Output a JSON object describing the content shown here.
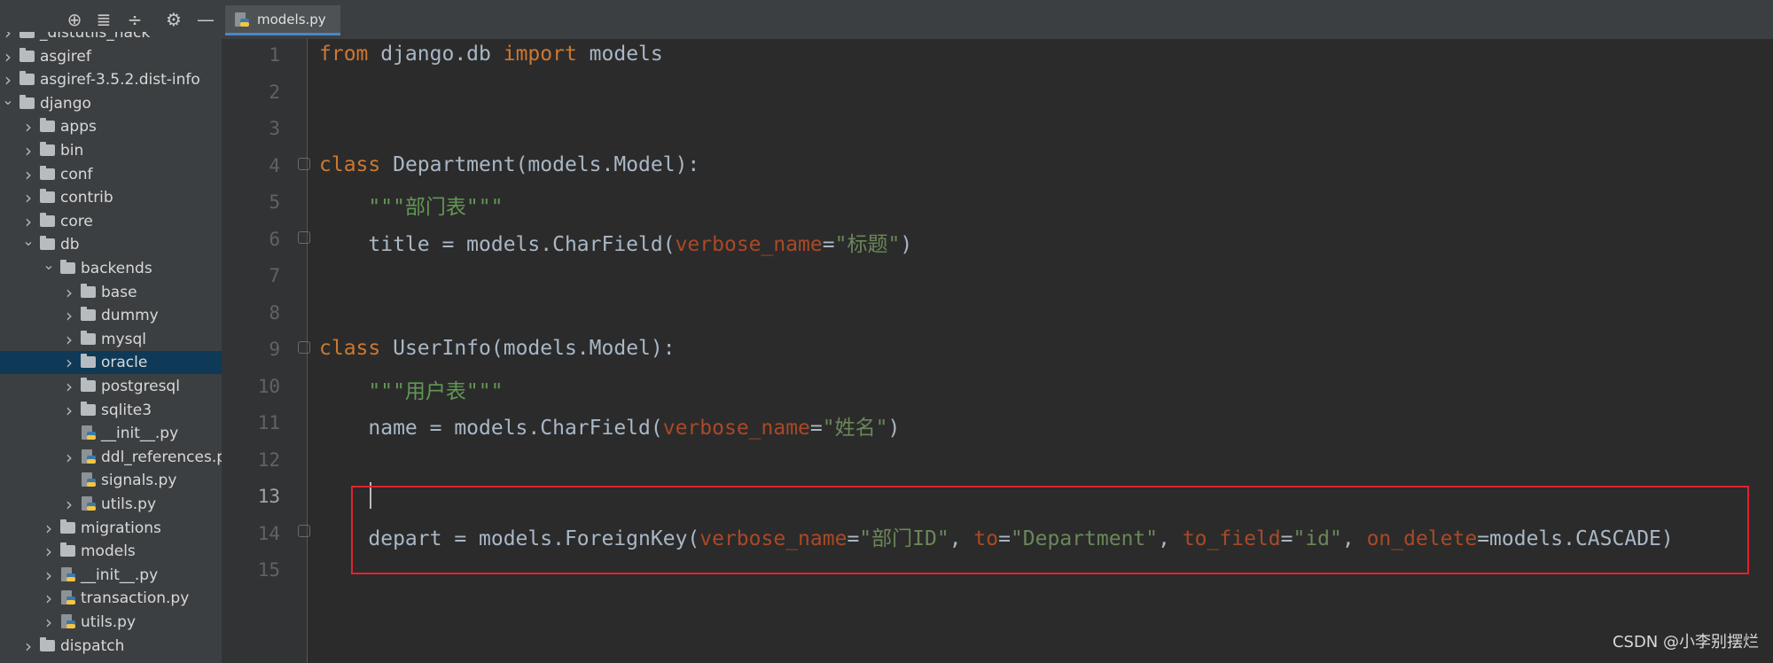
{
  "sidebar": {
    "toolbar": [
      {
        "icon": "crosshair-icon",
        "glyph": "⊕"
      },
      {
        "icon": "expand-all-icon",
        "glyph": "≣"
      },
      {
        "icon": "collapse-all-icon",
        "glyph": "÷"
      },
      {
        "icon": "gear-icon",
        "glyph": "⚙"
      },
      {
        "icon": "minimize-icon",
        "glyph": "—"
      }
    ],
    "tree": [
      {
        "label": "_distutils_hack",
        "type": "folder",
        "level": 0,
        "expanded": false
      },
      {
        "label": "asgiref",
        "type": "folder",
        "level": 0,
        "expanded": false
      },
      {
        "label": "asgiref-3.5.2.dist-info",
        "type": "folder",
        "level": 0,
        "expanded": false
      },
      {
        "label": "django",
        "type": "folder",
        "level": 0,
        "expanded": true
      },
      {
        "label": "apps",
        "type": "folder",
        "level": 1,
        "expanded": false
      },
      {
        "label": "bin",
        "type": "folder",
        "level": 1,
        "expanded": false
      },
      {
        "label": "conf",
        "type": "folder",
        "level": 1,
        "expanded": false
      },
      {
        "label": "contrib",
        "type": "folder",
        "level": 1,
        "expanded": false
      },
      {
        "label": "core",
        "type": "folder",
        "level": 1,
        "expanded": false
      },
      {
        "label": "db",
        "type": "folder",
        "level": 1,
        "expanded": true
      },
      {
        "label": "backends",
        "type": "folder",
        "level": 2,
        "expanded": true
      },
      {
        "label": "base",
        "type": "folder",
        "level": 3,
        "expanded": false
      },
      {
        "label": "dummy",
        "type": "folder",
        "level": 3,
        "expanded": false
      },
      {
        "label": "mysql",
        "type": "folder",
        "level": 3,
        "expanded": false
      },
      {
        "label": "oracle",
        "type": "folder",
        "level": 3,
        "expanded": false,
        "selected": true
      },
      {
        "label": "postgresql",
        "type": "folder",
        "level": 3,
        "expanded": false
      },
      {
        "label": "sqlite3",
        "type": "folder",
        "level": 3,
        "expanded": false
      },
      {
        "label": "__init__.py",
        "type": "file",
        "level": 3
      },
      {
        "label": "ddl_references.py",
        "type": "file",
        "level": 3,
        "expandable": true
      },
      {
        "label": "signals.py",
        "type": "file",
        "level": 3
      },
      {
        "label": "utils.py",
        "type": "file",
        "level": 3,
        "expandable": true
      },
      {
        "label": "migrations",
        "type": "folder",
        "level": 2,
        "expanded": false
      },
      {
        "label": "models",
        "type": "folder",
        "level": 2,
        "expanded": false
      },
      {
        "label": "__init__.py",
        "type": "file",
        "level": 2,
        "expandable": true
      },
      {
        "label": "transaction.py",
        "type": "file",
        "level": 2,
        "expandable": true
      },
      {
        "label": "utils.py",
        "type": "file",
        "level": 2,
        "expandable": true
      },
      {
        "label": "dispatch",
        "type": "folder",
        "level": 1,
        "expanded": false
      }
    ]
  },
  "tabs": [
    {
      "label": "models.py",
      "icon": "python-file-icon",
      "active": true
    }
  ],
  "editor": {
    "line_numbers": [
      "1",
      "2",
      "3",
      "4",
      "5",
      "6",
      "7",
      "8",
      "9",
      "10",
      "11",
      "12",
      "13",
      "14",
      "15"
    ],
    "current_line": "13",
    "lines": [
      [
        {
          "t": "from",
          "c": "kw"
        },
        {
          "t": " django.db ",
          "c": ""
        },
        {
          "t": "import",
          "c": "kw"
        },
        {
          "t": " models",
          "c": ""
        }
      ],
      [],
      [],
      [
        {
          "t": "class",
          "c": "kw"
        },
        {
          "t": " Department(models.Model):",
          "c": ""
        }
      ],
      [
        {
          "t": "    ",
          "c": ""
        },
        {
          "t": "\"\"\"部门表\"\"\"",
          "c": "doc"
        }
      ],
      [
        {
          "t": "    title = models.CharField(",
          "c": ""
        },
        {
          "t": "verbose_name",
          "c": "param"
        },
        {
          "t": "=",
          "c": ""
        },
        {
          "t": "\"标题\"",
          "c": "str"
        },
        {
          "t": ")",
          "c": ""
        }
      ],
      [],
      [],
      [
        {
          "t": "class",
          "c": "kw"
        },
        {
          "t": " UserInfo(models.Model):",
          "c": ""
        }
      ],
      [
        {
          "t": "    ",
          "c": ""
        },
        {
          "t": "\"\"\"用户表\"\"\"",
          "c": "doc"
        }
      ],
      [
        {
          "t": "    name = models.CharField(",
          "c": ""
        },
        {
          "t": "verbose_name",
          "c": "param"
        },
        {
          "t": "=",
          "c": ""
        },
        {
          "t": "\"姓名\"",
          "c": "str"
        },
        {
          "t": ")",
          "c": ""
        }
      ],
      [],
      [],
      [
        {
          "t": "    depart = models.ForeignKey(",
          "c": ""
        },
        {
          "t": "verbose_name",
          "c": "param"
        },
        {
          "t": "=",
          "c": ""
        },
        {
          "t": "\"部门ID\"",
          "c": "str"
        },
        {
          "t": ", ",
          "c": ""
        },
        {
          "t": "to",
          "c": "param"
        },
        {
          "t": "=",
          "c": ""
        },
        {
          "t": "\"Department\"",
          "c": "str"
        },
        {
          "t": ", ",
          "c": ""
        },
        {
          "t": "to_field",
          "c": "param"
        },
        {
          "t": "=",
          "c": ""
        },
        {
          "t": "\"id\"",
          "c": "str"
        },
        {
          "t": ", ",
          "c": ""
        },
        {
          "t": "on_delete",
          "c": "param"
        },
        {
          "t": "=models.CASCADE)",
          "c": ""
        }
      ],
      []
    ]
  },
  "colors": {
    "keyword": "#cc7832",
    "string": "#6a8759",
    "docstring": "#629755",
    "param": "#aa4926",
    "text": "#a9b7c6",
    "highlight_box": "#e0232f",
    "selection": "#0e3a57"
  },
  "watermark": "CSDN @小李别摆烂"
}
